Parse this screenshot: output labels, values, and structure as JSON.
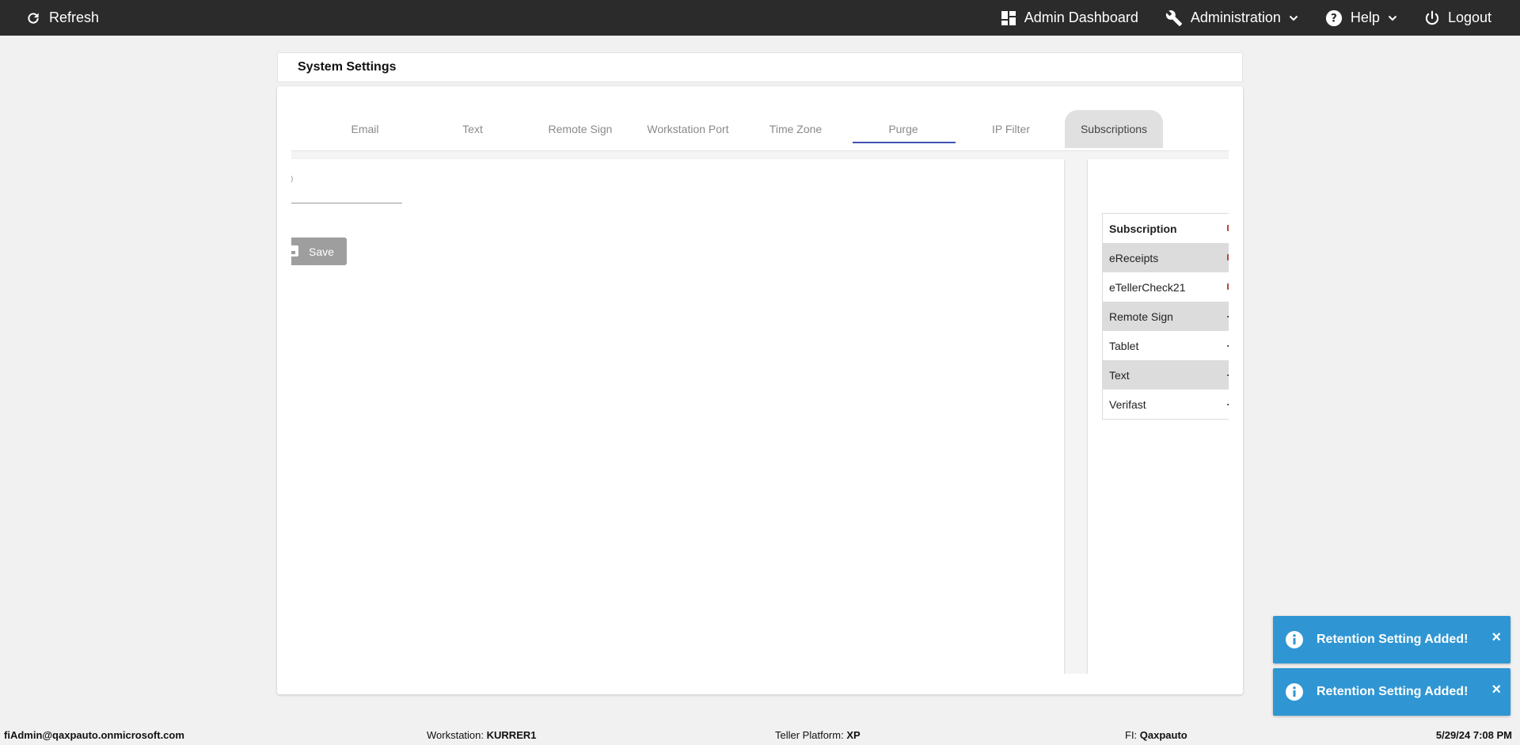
{
  "topbar": {
    "refresh_label": "Refresh",
    "admin_dashboard_label": "Admin Dashboard",
    "administration_label": "Administration",
    "help_label": "Help",
    "logout_label": "Logout"
  },
  "page": {
    "title": "System Settings"
  },
  "tabs": [
    {
      "label": "Email"
    },
    {
      "label": "Text"
    },
    {
      "label": "Remote Sign"
    },
    {
      "label": "Workstation Port"
    },
    {
      "label": "Time Zone"
    },
    {
      "label": "Purge"
    },
    {
      "label": "IP Filter"
    },
    {
      "label": "Subscriptions"
    }
  ],
  "left_panel": {
    "field_label_fragment": "s)",
    "save_label": "Save"
  },
  "subscriptions_table": {
    "header": "Subscription",
    "rows": [
      {
        "name": "eReceipts"
      },
      {
        "name": "eTellerCheck21"
      },
      {
        "name": "Remote Sign"
      },
      {
        "name": "Tablet"
      },
      {
        "name": "Text"
      },
      {
        "name": "Verifast"
      }
    ]
  },
  "toasts": [
    {
      "message": "Retention Setting Added!",
      "close": "×"
    },
    {
      "message": "Retention Setting Added!",
      "close": "×"
    }
  ],
  "statusbar": {
    "user": "fiAdmin@qaxpauto.onmicrosoft.com",
    "workstation_label": "Workstation:",
    "workstation_value": "KURRER1",
    "platform_label": "Teller Platform:",
    "platform_value": "XP",
    "fi_label": "FI:",
    "fi_value": "Qaxpauto",
    "datetime": "5/29/24 7:08 PM"
  },
  "colors": {
    "topbar": "#2b2b2b",
    "tab_underline": "#3f51b5",
    "toast": "#2f96d3",
    "save_button": "#9e9e9e"
  }
}
